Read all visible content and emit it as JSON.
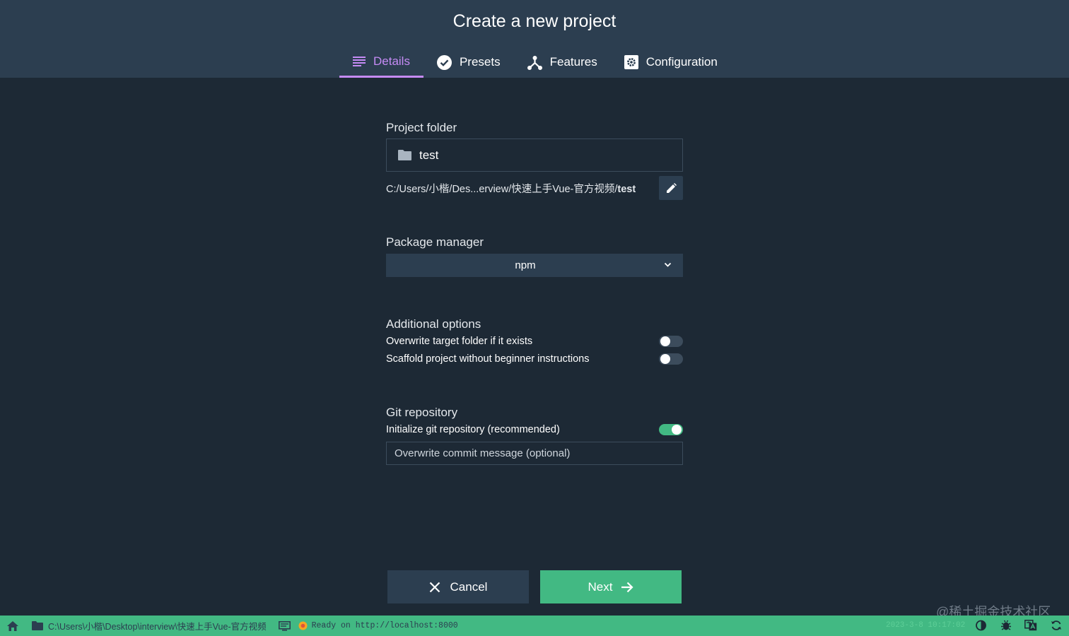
{
  "header": {
    "title": "Create a new project",
    "tabs": [
      {
        "label": "Details",
        "icon": "list-icon",
        "active": true
      },
      {
        "label": "Presets",
        "icon": "check-circle-icon",
        "active": false
      },
      {
        "label": "Features",
        "icon": "merge-icon",
        "active": false
      },
      {
        "label": "Configuration",
        "icon": "settings-box-icon",
        "active": false
      }
    ]
  },
  "details": {
    "project_folder_label": "Project folder",
    "folder_value": "test",
    "path_prefix": "C:/Users/小楷/Des...erview/快速上手Vue-官方视频/",
    "path_folder": "test",
    "package_manager_label": "Package manager",
    "package_manager_value": "npm",
    "additional_options_label": "Additional options",
    "options": [
      {
        "label": "Overwrite target folder if it exists",
        "enabled": false
      },
      {
        "label": "Scaffold project without beginner instructions",
        "enabled": false
      }
    ],
    "git_label": "Git repository",
    "git_init_label": "Initialize git repository (recommended)",
    "git_init_enabled": true,
    "commit_placeholder": "Overwrite commit message (optional)"
  },
  "actions": {
    "cancel_label": "Cancel",
    "next_label": "Next"
  },
  "statusbar": {
    "cwd": "C:\\Users\\小楷\\Desktop\\interview\\快速上手Vue-官方视频",
    "log": "Ready on http://localhost:8000",
    "time": "2023-3-8 10:17:02"
  },
  "watermark": "@稀土掘金技术社区",
  "colors": {
    "accent": "#42b983",
    "tab_active": "#c58bf5",
    "background": "#1d2935",
    "header": "#2c3e50"
  }
}
